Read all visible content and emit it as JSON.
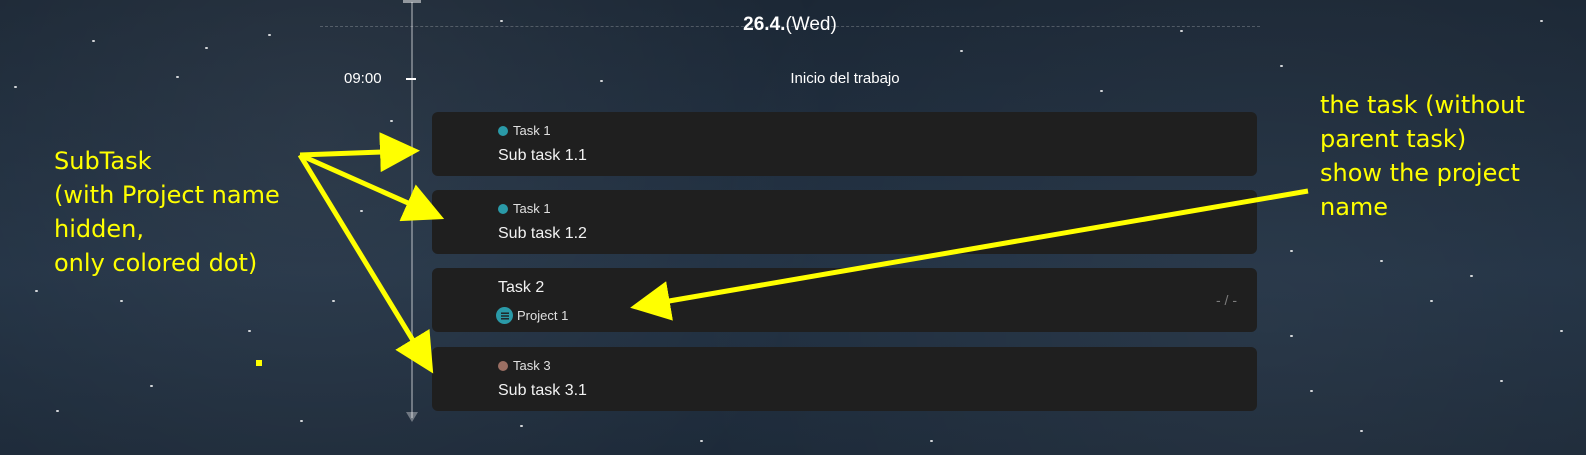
{
  "date": {
    "day": "26.4.",
    "weekday": "(Wed)"
  },
  "timeline": {
    "time": "09:00",
    "event": "Inicio del trabajo"
  },
  "cards": [
    {
      "kind": "subtask",
      "parent": "Task 1",
      "dot_color": "#2a9aa8",
      "title": "Sub task 1.1"
    },
    {
      "kind": "subtask",
      "parent": "Task 1",
      "dot_color": "#2a9aa8",
      "title": "Sub task 1.2"
    },
    {
      "kind": "task",
      "title": "Task 2",
      "project": "Project 1",
      "project_color": "#2a9aa8",
      "time_estimate": "- / -"
    },
    {
      "kind": "subtask",
      "parent": "Task 3",
      "dot_color": "#9b6f63",
      "title": "Sub task 3.1"
    }
  ],
  "annotations": {
    "left": "SubTask\n(with Project name\nhidden,\nonly colored dot)",
    "right": "the task (without\nparent task)\nshow the project\nname",
    "color": "#ffff00"
  },
  "icons": {
    "project": "list-icon",
    "dot": "colored-dot-icon"
  }
}
